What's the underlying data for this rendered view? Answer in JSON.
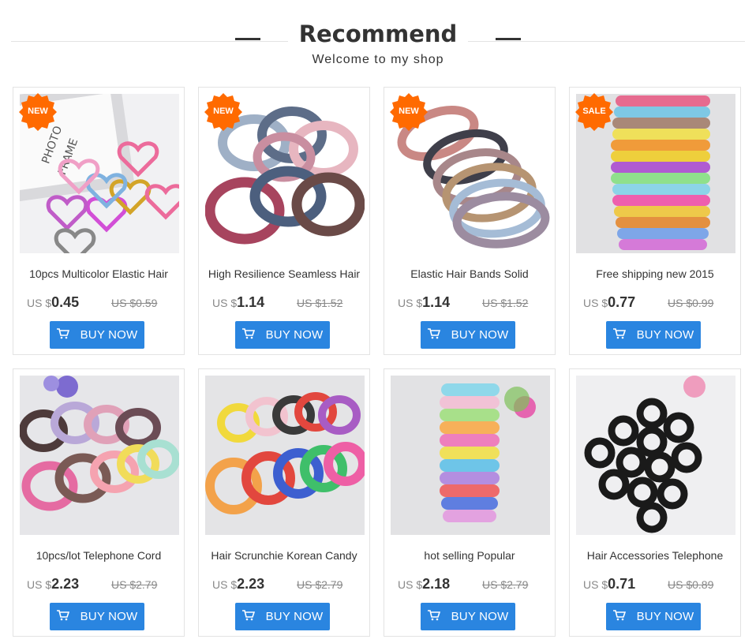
{
  "header": {
    "title": "Recommend",
    "subtitle": "Welcome to my shop"
  },
  "colors": {
    "accent": "#2a85e0",
    "badge": "#ff6a00"
  },
  "products": [
    {
      "name": "10pcs Multicolor Elastic Hair",
      "currency": "US $",
      "price": "0.45",
      "old_price": "US $0.59",
      "badge": "NEW",
      "button": "BUY NOW"
    },
    {
      "name": "High Resilience Seamless Hair",
      "currency": "US $",
      "price": "1.14",
      "old_price": "US $1.52",
      "badge": "NEW",
      "button": "BUY NOW"
    },
    {
      "name": "Elastic Hair Bands Solid",
      "currency": "US $",
      "price": "1.14",
      "old_price": "US $1.52",
      "badge": "NEW",
      "button": "BUY NOW"
    },
    {
      "name": "Free shipping new 2015",
      "currency": "US $",
      "price": "0.77",
      "old_price": "US $0.99",
      "badge": "SALE",
      "button": "BUY NOW"
    },
    {
      "name": "10pcs/lot Telephone Cord",
      "currency": "US $",
      "price": "2.23",
      "old_price": "US $2.79",
      "badge": "",
      "button": "BUY NOW"
    },
    {
      "name": "Hair Scrunchie Korean Candy",
      "currency": "US $",
      "price": "2.23",
      "old_price": "US $2.79",
      "badge": "",
      "button": "BUY NOW"
    },
    {
      "name": "hot selling Popular",
      "currency": "US $",
      "price": "2.18",
      "old_price": "US $2.79",
      "badge": "",
      "button": "BUY NOW"
    },
    {
      "name": "Hair Accessories Telephone",
      "currency": "US $",
      "price": "0.71",
      "old_price": "US $0.89",
      "badge": "",
      "button": "BUY NOW"
    }
  ]
}
